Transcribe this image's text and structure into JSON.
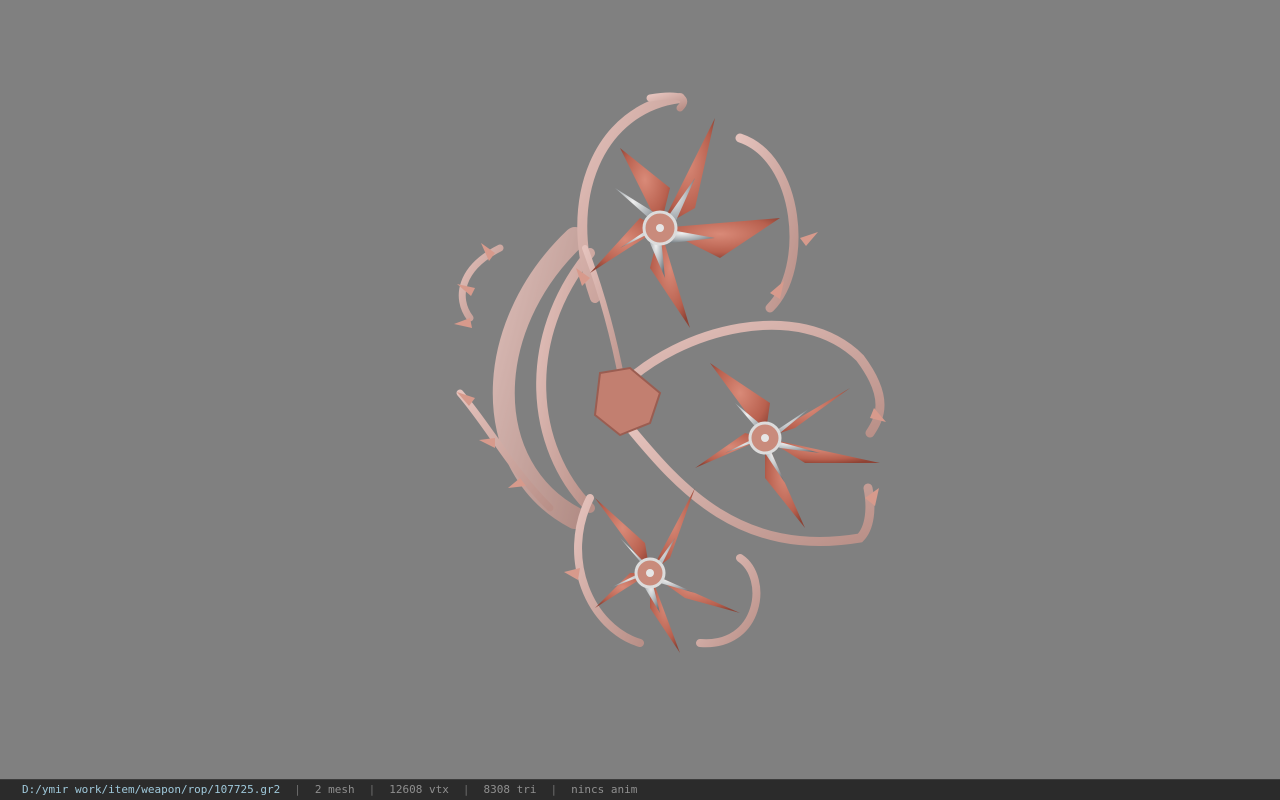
{
  "viewer": {
    "background_color": "#808080",
    "model_name": "thorn-rose-weapon-model"
  },
  "statusbar": {
    "file_path": "D:/ymir work/item/weapon/rop/107725.gr2",
    "separator": "|",
    "mesh_count": "2 mesh",
    "vertex_count": "12608 vtx",
    "triangle_count": "8308 tri",
    "animation": "nincs anim"
  }
}
